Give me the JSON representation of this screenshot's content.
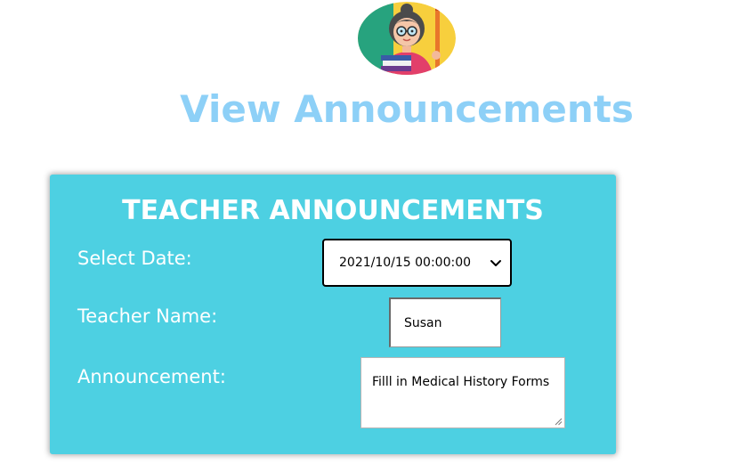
{
  "header": {
    "title": "View Announcements",
    "avatar_icon": "teacher-avatar-icon"
  },
  "card": {
    "title": "TEACHER ANNOUNCEMENTS",
    "date_label": "Select Date:",
    "date_value": "2021/10/15 00:00:00",
    "teacher_label": "Teacher Name:",
    "teacher_value": "Susan",
    "announcement_label": "Announcement:",
    "announcement_value": "Filll in Medical History Forms"
  },
  "colors": {
    "title": "#8dd0f7",
    "card_background": "#4dd0e2",
    "card_text": "#ffffff"
  }
}
